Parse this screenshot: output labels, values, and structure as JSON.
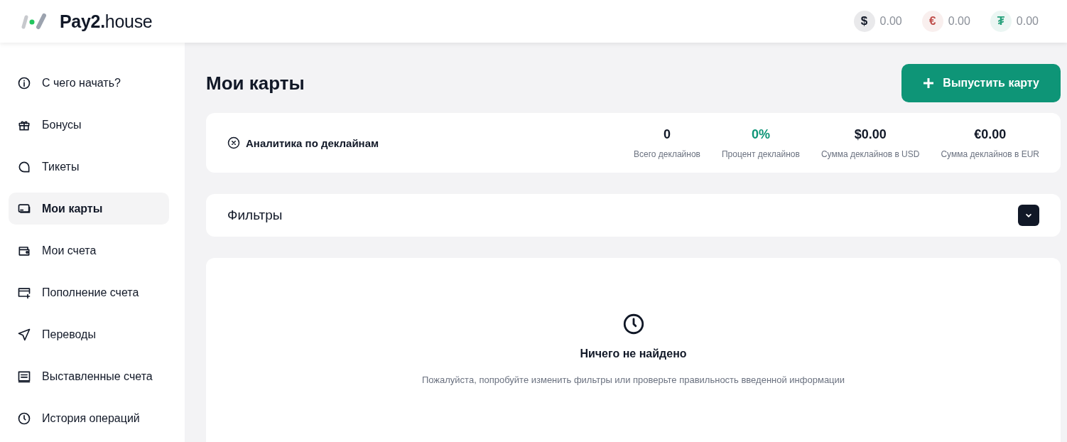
{
  "header": {
    "logo": {
      "brand": "Pay2.",
      "suffix": "house"
    },
    "balances": [
      {
        "symbol": "$",
        "color": "#111827",
        "amount": "0.00"
      },
      {
        "symbol": "€",
        "color": "#c0504d",
        "amount": "0.00"
      },
      {
        "symbol": "₮",
        "color": "#26a17b",
        "amount": "0.00"
      }
    ]
  },
  "sidebar": {
    "items": [
      {
        "label": "С чего начать?",
        "selected": false
      },
      {
        "label": "Бонусы",
        "selected": false
      },
      {
        "label": "Тикеты",
        "selected": false
      },
      {
        "label": "Мои карты",
        "selected": true
      },
      {
        "label": "Мои счета",
        "selected": false
      },
      {
        "label": "Пополнение счета",
        "selected": false
      },
      {
        "label": "Переводы",
        "selected": false
      },
      {
        "label": "Выставленные счета",
        "selected": false
      },
      {
        "label": "История операций",
        "selected": false
      }
    ]
  },
  "page": {
    "title": "Мои карты",
    "action_button": "Выпустить карту"
  },
  "analytics": {
    "title": "Аналитика по деклайнам",
    "expanded": true,
    "stats": [
      {
        "value": "0",
        "label": "Всего деклайнов",
        "kind": "plain"
      },
      {
        "value": "0%",
        "label": "Процент деклайнов",
        "kind": "accent"
      },
      {
        "value": "$0.00",
        "label": "Сумма деклайнов в USD",
        "kind": "plain"
      },
      {
        "value": "€0.00",
        "label": "Сумма деклайнов в EUR",
        "kind": "plain"
      }
    ]
  },
  "filters": {
    "title": "Фильтры",
    "expanded": false
  },
  "empty_state": {
    "title": "Ничего не найдено",
    "message": "Пожалуйста, попробуйте изменить фильтры или проверьте правильность введенной информации"
  }
}
